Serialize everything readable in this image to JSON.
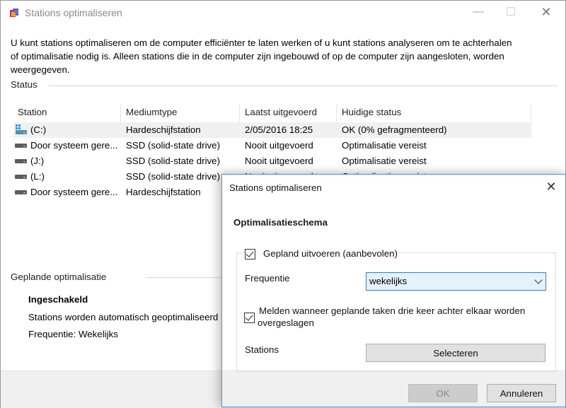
{
  "window": {
    "title": "Stations optimaliseren",
    "icon": "defrag-app-icon",
    "controls": {
      "minimize": "—",
      "maximize": "☐",
      "close": "✕"
    }
  },
  "intro_text": "U kunt stations optimaliseren om de computer efficiënter te laten werken of u kunt stations analyseren om te achterhalen of optimalisatie nodig is. Alleen stations die in de computer zijn ingebouwd of op de computer zijn aangesloten, worden weergegeven.",
  "status_section": {
    "label": "Status",
    "columns": [
      "Station",
      "Mediumtype",
      "Laatst uitgevoerd",
      "Huidige status"
    ],
    "rows": [
      {
        "icon": "system-drive-icon",
        "station": "(C:)",
        "media": "Hardeschijfstation",
        "last_run": "2/05/2016 18:25",
        "status": "OK (0% gefragmenteerd)",
        "selected": true
      },
      {
        "icon": "drive-icon",
        "station": "Door systeem gere...",
        "media": "SSD (solid-state drive)",
        "last_run": "Nooit uitgevoerd",
        "status": "Optimalisatie vereist"
      },
      {
        "icon": "drive-icon",
        "station": "(J:)",
        "media": "SSD (solid-state drive)",
        "last_run": "Nooit uitgevoerd",
        "status": "Optimalisatie vereist"
      },
      {
        "icon": "drive-icon",
        "station": "(L:)",
        "media": "SSD (solid-state drive)",
        "last_run": "Nooit uitgevoerd",
        "status": "Optimalisatie vereist"
      },
      {
        "icon": "drive-icon",
        "station": "Door systeem gere...",
        "media": "Hardeschijfstation",
        "last_run": "",
        "status": ""
      }
    ]
  },
  "scheduled_section": {
    "label": "Geplande optimalisatie",
    "state": "Ingeschakeld",
    "description": "Stations worden automatisch geoptimaliseerd",
    "frequency": "Frequentie: Wekelijks"
  },
  "dialog": {
    "title": "Stations optimaliseren",
    "close": "✕",
    "heading": "Optimalisatieschema",
    "run_scheduled": {
      "label": "Gepland uitvoeren (aanbevolen)",
      "checked": true
    },
    "frequency": {
      "label": "Frequentie",
      "value": "wekelijks"
    },
    "notify": {
      "label_line1": "Melden wanneer geplande taken drie keer achter elkaar worden",
      "label_line2": "overgeslagen",
      "checked": true
    },
    "stations": {
      "label": "Stations",
      "button": "Selecteren"
    },
    "ok_button": "OK",
    "cancel_button": "Annuleren"
  }
}
